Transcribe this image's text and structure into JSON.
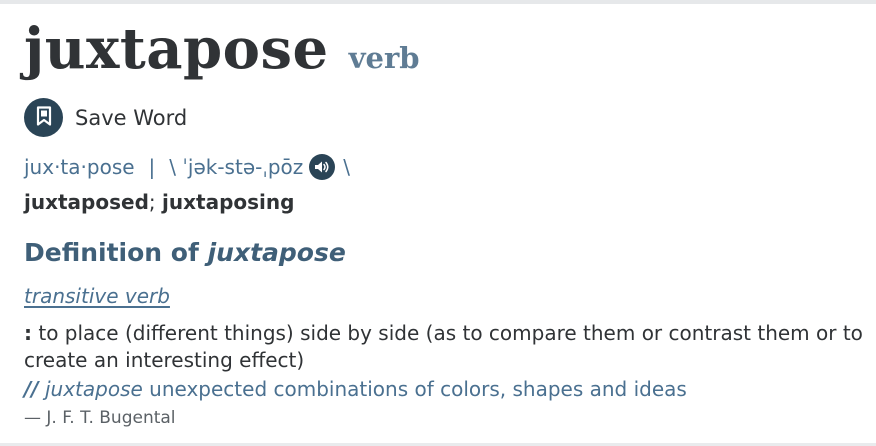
{
  "entry": {
    "headword": "juxtapose",
    "part_of_speech": "verb"
  },
  "save": {
    "label": "Save Word"
  },
  "pronunciation": {
    "syllables": "jux·ta·pose",
    "separator": "|",
    "open": "\\ ˈjək-stə-ˌpōz",
    "close": "\\"
  },
  "inflections": {
    "first": "juxtaposed",
    "separator": ";",
    "second": "juxtaposing"
  },
  "definition_section": {
    "heading_prefix": "Definition of",
    "heading_word": "juxtapose",
    "sense_label": "transitive verb",
    "colon": ":",
    "text": "to place (different things) side by side (as to compare them or contrast them or to create an interesting effect)",
    "example_marker": "//",
    "example_word": "juxtapose",
    "example_rest": " unexpected combinations of colors, shapes and ideas",
    "citation": "— J. F. T. Bugental"
  },
  "colors": {
    "headword": "#303336",
    "pos": "#5f7c94",
    "accent": "#4a7090",
    "icon_bg": "#2a4456"
  },
  "icons": {
    "save": "bookmark-icon",
    "audio": "speaker-icon"
  }
}
